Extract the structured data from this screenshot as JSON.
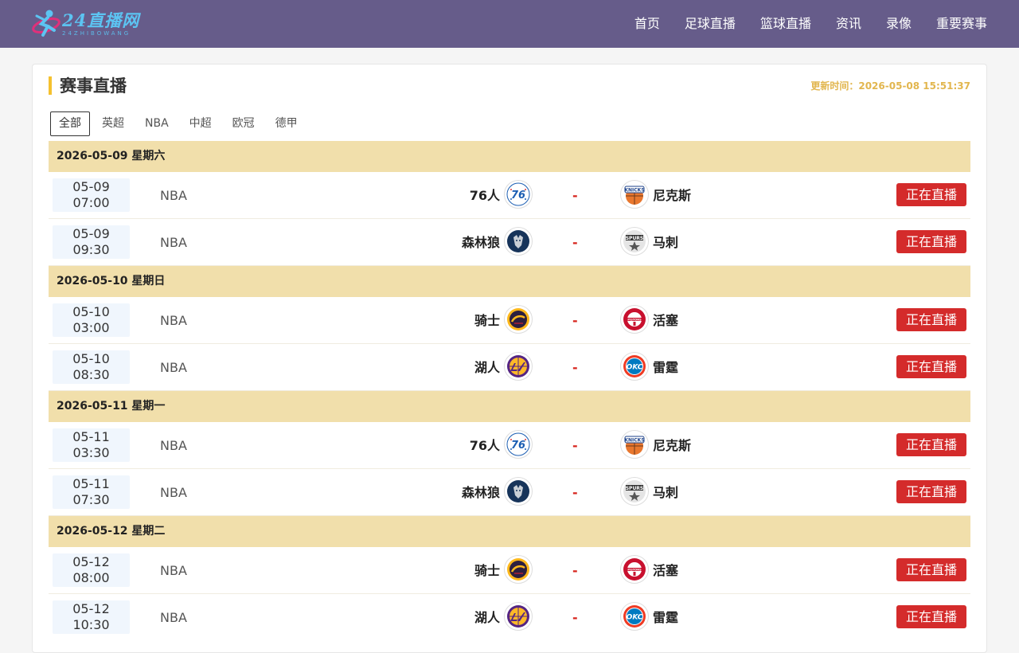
{
  "header": {
    "logo_title": "24直播网",
    "logo_sub": "24ZHIBOWANG",
    "nav": [
      "首页",
      "足球直播",
      "篮球直播",
      "资讯",
      "录像",
      "重要赛事"
    ]
  },
  "panel": {
    "title": "赛事直播",
    "update_label": "更新时间：",
    "update_time": "2026-05-08 15:51:37",
    "tabs": [
      "全部",
      "英超",
      "NBA",
      "中超",
      "欧冠",
      "德甲"
    ],
    "active_tab": "全部",
    "live_label": "正在直播",
    "vs": "-"
  },
  "colors": {
    "header": "#665c8a",
    "accent": "#f5c12f",
    "day_bg": "#f1dfab",
    "live": "#d42b2b",
    "update": "#e2b64e"
  },
  "days": [
    {
      "date": "2026-05-09 星期六",
      "matches": [
        {
          "date": "05-09",
          "time": "07:00",
          "league": "NBA",
          "home": "76人",
          "home_icon": "sixers-logo-icon",
          "away": "尼克斯",
          "away_icon": "knicks-logo-icon"
        },
        {
          "date": "05-09",
          "time": "09:30",
          "league": "NBA",
          "home": "森林狼",
          "home_icon": "timberwolves-logo-icon",
          "away": "马刺",
          "away_icon": "spurs-logo-icon"
        }
      ]
    },
    {
      "date": "2026-05-10 星期日",
      "matches": [
        {
          "date": "05-10",
          "time": "03:00",
          "league": "NBA",
          "home": "骑士",
          "home_icon": "cavaliers-logo-icon",
          "away": "活塞",
          "away_icon": "pistons-logo-icon"
        },
        {
          "date": "05-10",
          "time": "08:30",
          "league": "NBA",
          "home": "湖人",
          "home_icon": "lakers-logo-icon",
          "away": "雷霆",
          "away_icon": "thunder-logo-icon"
        }
      ]
    },
    {
      "date": "2026-05-11 星期一",
      "matches": [
        {
          "date": "05-11",
          "time": "03:30",
          "league": "NBA",
          "home": "76人",
          "home_icon": "sixers-logo-icon",
          "away": "尼克斯",
          "away_icon": "knicks-logo-icon"
        },
        {
          "date": "05-11",
          "time": "07:30",
          "league": "NBA",
          "home": "森林狼",
          "home_icon": "timberwolves-logo-icon",
          "away": "马刺",
          "away_icon": "spurs-logo-icon"
        }
      ]
    },
    {
      "date": "2026-05-12 星期二",
      "matches": [
        {
          "date": "05-12",
          "time": "08:00",
          "league": "NBA",
          "home": "骑士",
          "home_icon": "cavaliers-logo-icon",
          "away": "活塞",
          "away_icon": "pistons-logo-icon"
        },
        {
          "date": "05-12",
          "time": "10:30",
          "league": "NBA",
          "home": "湖人",
          "home_icon": "lakers-logo-icon",
          "away": "雷霆",
          "away_icon": "thunder-logo-icon"
        }
      ]
    }
  ]
}
